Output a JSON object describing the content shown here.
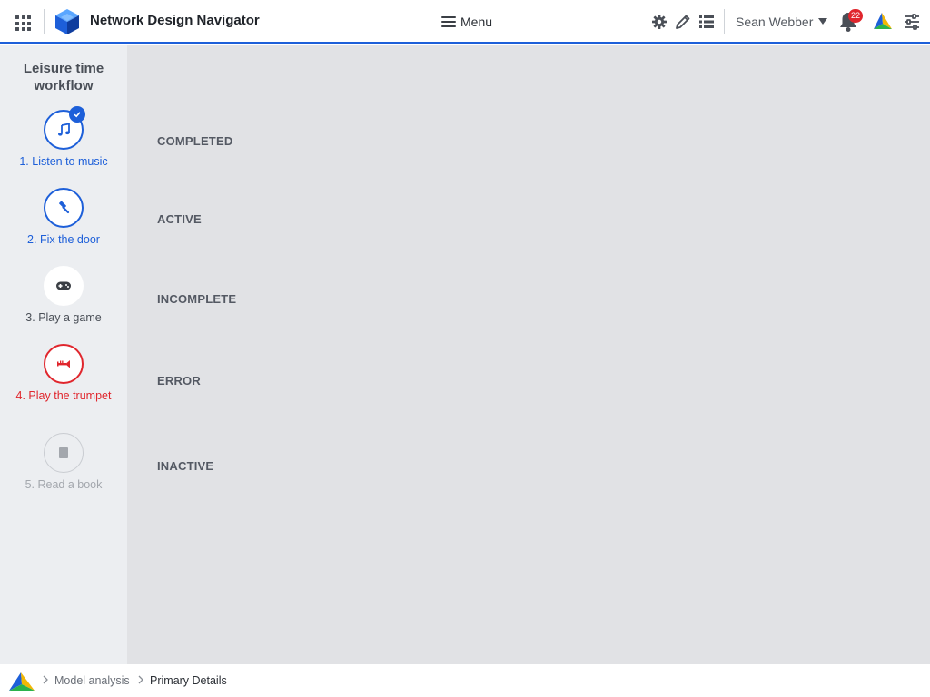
{
  "header": {
    "app_title": "Network Design Navigator",
    "menu_label": "Menu",
    "user_name": "Sean Webber",
    "notification_count": "22",
    "icons": [
      "apps-grid-icon",
      "cube-logo-icon",
      "hamburger-icon",
      "gear-icon",
      "pencil-icon",
      "list-icon",
      "bell-icon",
      "brand-logo-icon",
      "sliders-icon"
    ]
  },
  "sidebar": {
    "workflow_title": "Leisure time workflow",
    "steps": [
      {
        "label": "1. Listen to music",
        "state": "completed",
        "icon": "music-note-icon"
      },
      {
        "label": "2. Fix the door",
        "state": "active",
        "icon": "hammer-icon"
      },
      {
        "label": "3. Play a game",
        "state": "incomplete",
        "icon": "gamepad-icon"
      },
      {
        "label": "4. Play the trumpet",
        "state": "error",
        "icon": "trumpet-icon"
      },
      {
        "label": "5. Read a book",
        "state": "inactive",
        "icon": "book-icon"
      }
    ]
  },
  "main": {
    "states": [
      "COMPLETED",
      "ACTIVE",
      "INCOMPLETE",
      "ERROR",
      "INACTIVE"
    ]
  },
  "breadcrumb": {
    "items": [
      "Model analysis",
      "Primary Details"
    ]
  },
  "colors": {
    "accent": "#1d5fd9",
    "error": "#e0262d",
    "sidebar_bg": "#eceef1",
    "main_bg": "#e1e2e5",
    "inactive": "#a3a7ad"
  }
}
